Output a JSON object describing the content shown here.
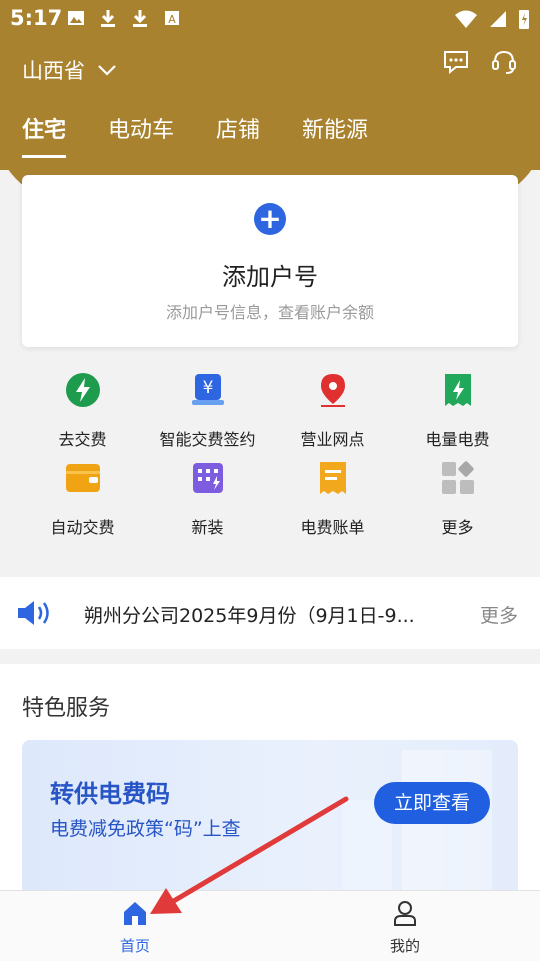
{
  "status_bar": {
    "time": "5:17"
  },
  "header": {
    "province": "山西省",
    "tabs": [
      "住宅",
      "电动车",
      "店铺",
      "新能源"
    ]
  },
  "add_card": {
    "title": "添加户号",
    "subtitle": "添加户号信息，查看账户余额"
  },
  "services": [
    {
      "label": "去交费",
      "icon": "lightning-circle-icon",
      "color": "#1f9b4e"
    },
    {
      "label": "智能交费签约",
      "icon": "yen-card-icon",
      "color": "#2d66e0"
    },
    {
      "label": "营业网点",
      "icon": "location-pin-icon",
      "color": "#e03030"
    },
    {
      "label": "电量电费",
      "icon": "lightning-receipt-icon",
      "color": "#22a85a"
    },
    {
      "label": "自动交费",
      "icon": "wallet-icon",
      "color": "#f0a414"
    },
    {
      "label": "新装",
      "icon": "meter-icon",
      "color": "#7d5ce0"
    },
    {
      "label": "电费账单",
      "icon": "bill-icon",
      "color": "#f2a81c"
    },
    {
      "label": "更多",
      "icon": "grid-more-icon",
      "color": "#9a9a9a"
    }
  ],
  "notice": {
    "text": "朔州分公司2025年9月份（9月1日-9...",
    "more": "更多"
  },
  "featured": {
    "title": "特色服务",
    "promo": {
      "title": "转供电费码",
      "subtitle": "电费减免政策“码”上查",
      "button": "立即查看"
    }
  },
  "bottom_nav": [
    {
      "label": "首页",
      "active": true
    },
    {
      "label": "我的",
      "active": false
    }
  ],
  "colors": {
    "header": "#a9822f",
    "accent": "#2d66e0",
    "arrow": "#e03a3a"
  }
}
